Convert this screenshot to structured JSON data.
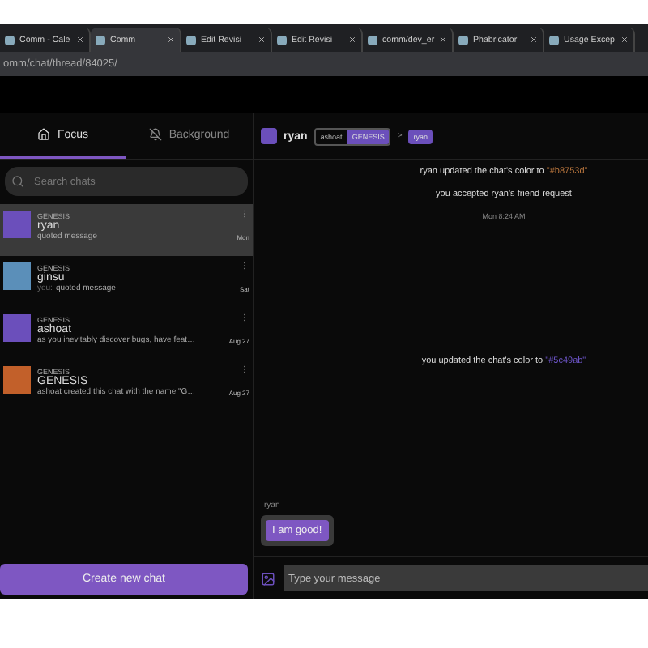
{
  "browser": {
    "tabs": [
      {
        "label": "Comm - Cale",
        "selected": false
      },
      {
        "label": "Comm",
        "selected": true
      },
      {
        "label": "Edit Revisi",
        "selected": false
      },
      {
        "label": "Edit Revisi",
        "selected": false
      },
      {
        "label": "comm/dev_er",
        "selected": false
      },
      {
        "label": "Phabricator",
        "selected": false
      },
      {
        "label": "Usage Excep",
        "selected": false
      }
    ],
    "address": "omm/chat/thread/84025/"
  },
  "sidebar": {
    "tabs": [
      {
        "label": "Focus",
        "selected": true
      },
      {
        "label": "Background",
        "selected": false
      }
    ],
    "search": {
      "placeholder": "Search chats"
    },
    "chats": [
      {
        "community": "GENESIS",
        "name": "ryan",
        "message": "quoted message",
        "time": "Mon",
        "color": "#6b4fbb",
        "selected": true
      },
      {
        "community": "GENESIS",
        "name": "ginsu",
        "prefix": "you:",
        "message": "quoted message",
        "time": "Sat",
        "color": "#5b8fb9",
        "selected": false
      },
      {
        "community": "GENESIS",
        "name": "ashoat",
        "message": "as you inevitably discover bugs, have feat…",
        "time": "Aug 27",
        "color": "#6b4fbb",
        "selected": false
      },
      {
        "community": "GENESIS",
        "name": "GENESIS",
        "message": "ashoat created this chat with the name \"G…",
        "time": "Aug 27",
        "color": "#c2602a",
        "selected": false
      }
    ],
    "create_button": "Create new chat"
  },
  "thread": {
    "name": "ryan",
    "color": "#6b4fbb",
    "breadcrumb": {
      "owner": "ashoat",
      "community": "GENESIS",
      "separator": ">",
      "thread": "ryan"
    },
    "messages": [
      {
        "kind": "notice",
        "text": "ryan updated the chat's color to ",
        "value": "\"#b8753d\"",
        "color": "#b8753d"
      },
      {
        "kind": "notice",
        "text": "you accepted ryan's friend request"
      },
      {
        "kind": "time",
        "text": "Mon 8:24 AM"
      },
      {
        "kind": "spacer"
      },
      {
        "kind": "notice",
        "text": "you updated the chat's color to ",
        "value": "\"#5c49ab\"",
        "color": "#6d55c8"
      },
      {
        "kind": "spacer"
      },
      {
        "kind": "bubble",
        "author": "ryan",
        "text": "I am good!"
      }
    ],
    "input": {
      "placeholder": "Type your message"
    }
  }
}
